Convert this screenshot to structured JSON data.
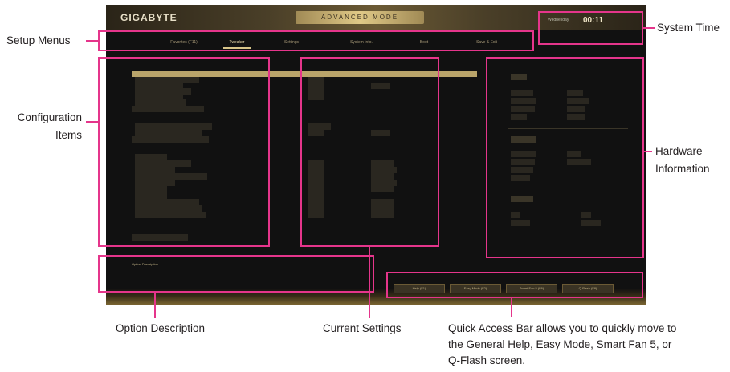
{
  "callouts": {
    "setup_menus": "Setup Menus",
    "system_time": "System Time",
    "config_items_line1": "Configuration",
    "config_items_line2": "Items",
    "hardware_info_line1": "Hardware",
    "hardware_info_line2": "Information",
    "option_description": "Option Description",
    "current_settings": "Current Settings",
    "quick_access_line1": "Quick Access Bar allows you to quickly move to",
    "quick_access_line2": "the General Help, Easy Mode, Smart Fan 5, or",
    "quick_access_line3": "Q-Flash screen."
  },
  "bios": {
    "logo": "GIGABYTE",
    "mode_title": "ADVANCED MODE",
    "clock": {
      "date": "Wednesday",
      "time": "00:11"
    },
    "tabs": [
      "Favorites (F11)",
      "Tweaker",
      "Settings",
      "System Info.",
      "Boot",
      "Save & Exit"
    ],
    "option_description_text": "Option Description",
    "quick_access": [
      "Help (F1)",
      "Easy Mode (F2)",
      "Smart Fan 5 (F6)",
      "Q-Flash (F8)"
    ],
    "accent": "#b9a46a"
  }
}
